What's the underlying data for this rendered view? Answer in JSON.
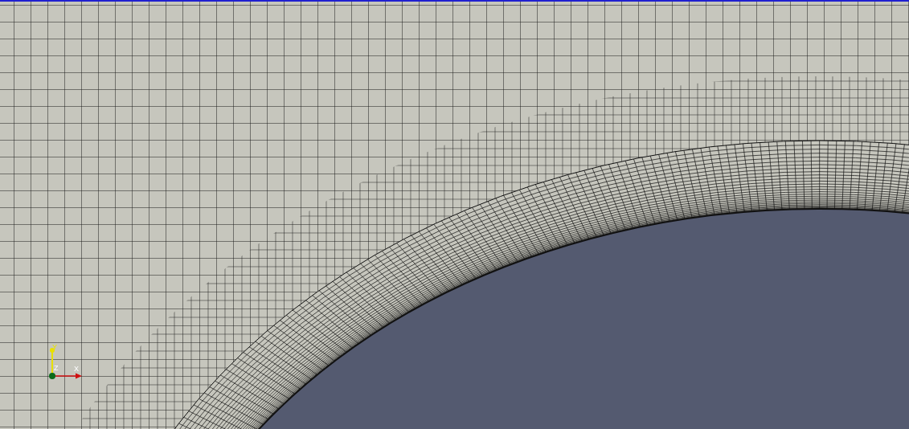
{
  "viewport": {
    "axes": [
      {
        "label": "Y"
      },
      {
        "label": "Z"
      },
      {
        "label": "X"
      }
    ]
  }
}
